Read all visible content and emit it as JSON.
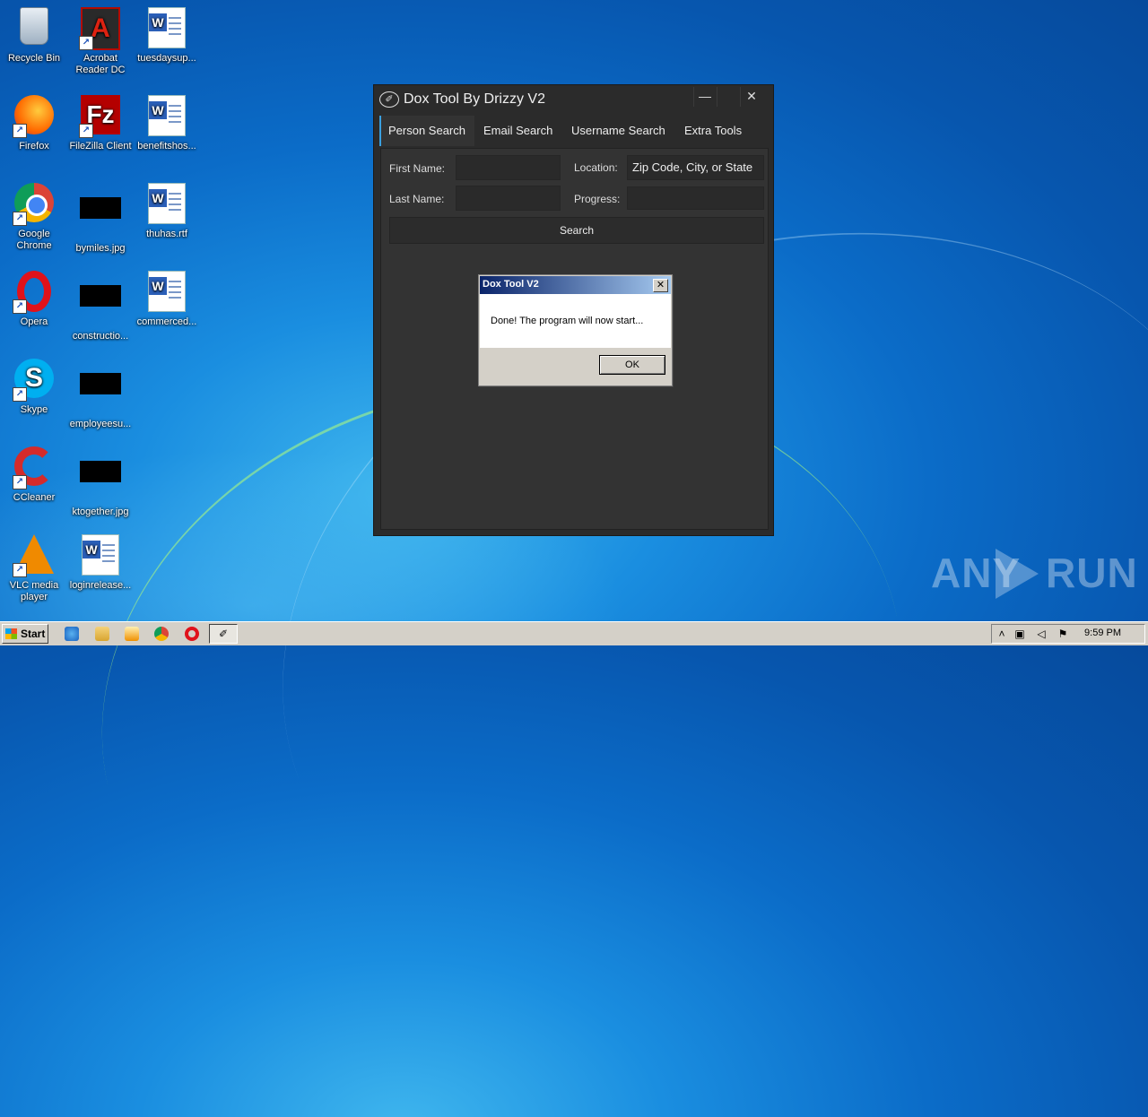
{
  "desktop": {
    "icons": [
      {
        "label": "Recycle Bin"
      },
      {
        "label": "Acrobat Reader DC"
      },
      {
        "label": "tuesdaysup..."
      },
      {
        "label": "Firefox"
      },
      {
        "label": "FileZilla Client"
      },
      {
        "label": "benefitshos..."
      },
      {
        "label": "Google Chrome"
      },
      {
        "label": "bymiles.jpg"
      },
      {
        "label": "thuhas.rtf"
      },
      {
        "label": "Opera"
      },
      {
        "label": "constructio..."
      },
      {
        "label": "commerced..."
      },
      {
        "label": "Skype"
      },
      {
        "label": "employeesu..."
      },
      {
        "label": "CCleaner"
      },
      {
        "label": "ktogether.jpg"
      },
      {
        "label": "VLC media player"
      },
      {
        "label": "loginrelease..."
      }
    ]
  },
  "app": {
    "title": "Dox Tool By Drizzy V2",
    "minimize_glyph": "—",
    "maximize_glyph": "",
    "close_glyph": "✕",
    "tabs": [
      {
        "label": "Person Search"
      },
      {
        "label": "Email Search"
      },
      {
        "label": "Username Search"
      },
      {
        "label": "Extra Tools"
      }
    ],
    "form": {
      "first_name_label": "First Name:",
      "first_name_value": "",
      "last_name_label": "Last Name:",
      "last_name_value": "",
      "location_label": "Location:",
      "location_value": "Zip Code, City, or State",
      "progress_label": "Progress:",
      "progress_value": "",
      "search_button": "Search"
    }
  },
  "dialog": {
    "title": "Dox Tool V2",
    "close_glyph": "✕",
    "message": "Done! The program will now start...",
    "ok_button": "OK"
  },
  "watermark": {
    "left": "ANY",
    "right": "RUN"
  },
  "taskbar": {
    "start_label": "Start",
    "clock": "9:59 PM"
  },
  "colors": {
    "accent_tab": "#3aa0e0",
    "app_bg": "#2b2b2b",
    "dialog_title": "#0a246a"
  }
}
